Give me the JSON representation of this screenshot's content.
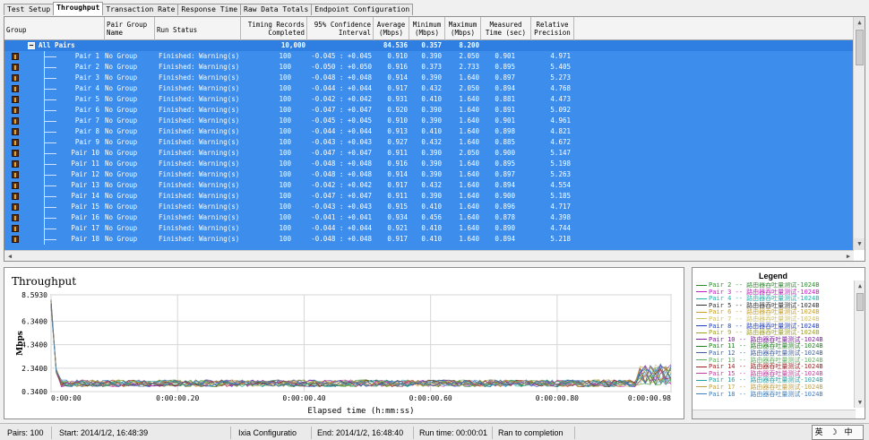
{
  "tabs": [
    "Test Setup",
    "Throughput",
    "Transaction Rate",
    "Response Time",
    "Raw Data Totals",
    "Endpoint Configuration"
  ],
  "active_tab": "Throughput",
  "table": {
    "headers": {
      "group": "Group",
      "pair_group_name": "Pair Group Name",
      "run_status": "Run Status",
      "timing_records": "Timing Records Completed",
      "confidence": "95% Confidence Interval",
      "average": "Average (Mbps)",
      "minimum": "Minimum (Mbps)",
      "maximum": "Maximum (Mbps)",
      "measured": "Measured Time (sec)",
      "precision": "Relative Precision"
    },
    "summary": {
      "label": "All Pairs",
      "records": "10,000",
      "average": "84.536",
      "minimum": "0.357",
      "maximum": "8.200"
    },
    "rows": [
      {
        "pair": "Pair 1",
        "group": "No Group",
        "status": "Finished: Warning(s)",
        "records": "100",
        "ci": "-0.045 : +0.045",
        "avg": "0.910",
        "min": "0.390",
        "max": "2.050",
        "time": "0.901",
        "prec": "4.971"
      },
      {
        "pair": "Pair 2",
        "group": "No Group",
        "status": "Finished: Warning(s)",
        "records": "100",
        "ci": "-0.050 : +0.050",
        "avg": "0.916",
        "min": "0.373",
        "max": "2.733",
        "time": "0.895",
        "prec": "5.405"
      },
      {
        "pair": "Pair 3",
        "group": "No Group",
        "status": "Finished: Warning(s)",
        "records": "100",
        "ci": "-0.048 : +0.048",
        "avg": "0.914",
        "min": "0.390",
        "max": "1.640",
        "time": "0.897",
        "prec": "5.273"
      },
      {
        "pair": "Pair 4",
        "group": "No Group",
        "status": "Finished: Warning(s)",
        "records": "100",
        "ci": "-0.044 : +0.044",
        "avg": "0.917",
        "min": "0.432",
        "max": "2.050",
        "time": "0.894",
        "prec": "4.768"
      },
      {
        "pair": "Pair 5",
        "group": "No Group",
        "status": "Finished: Warning(s)",
        "records": "100",
        "ci": "-0.042 : +0.042",
        "avg": "0.931",
        "min": "0.410",
        "max": "1.640",
        "time": "0.881",
        "prec": "4.473"
      },
      {
        "pair": "Pair 6",
        "group": "No Group",
        "status": "Finished: Warning(s)",
        "records": "100",
        "ci": "-0.047 : +0.047",
        "avg": "0.920",
        "min": "0.390",
        "max": "1.640",
        "time": "0.891",
        "prec": "5.092"
      },
      {
        "pair": "Pair 7",
        "group": "No Group",
        "status": "Finished: Warning(s)",
        "records": "100",
        "ci": "-0.045 : +0.045",
        "avg": "0.910",
        "min": "0.390",
        "max": "1.640",
        "time": "0.901",
        "prec": "4.961"
      },
      {
        "pair": "Pair 8",
        "group": "No Group",
        "status": "Finished: Warning(s)",
        "records": "100",
        "ci": "-0.044 : +0.044",
        "avg": "0.913",
        "min": "0.410",
        "max": "1.640",
        "time": "0.898",
        "prec": "4.821"
      },
      {
        "pair": "Pair 9",
        "group": "No Group",
        "status": "Finished: Warning(s)",
        "records": "100",
        "ci": "-0.043 : +0.043",
        "avg": "0.927",
        "min": "0.432",
        "max": "1.640",
        "time": "0.885",
        "prec": "4.672"
      },
      {
        "pair": "Pair 10",
        "group": "No Group",
        "status": "Finished: Warning(s)",
        "records": "100",
        "ci": "-0.047 : +0.047",
        "avg": "0.911",
        "min": "0.390",
        "max": "2.050",
        "time": "0.900",
        "prec": "5.147"
      },
      {
        "pair": "Pair 11",
        "group": "No Group",
        "status": "Finished: Warning(s)",
        "records": "100",
        "ci": "-0.048 : +0.048",
        "avg": "0.916",
        "min": "0.390",
        "max": "1.640",
        "time": "0.895",
        "prec": "5.198"
      },
      {
        "pair": "Pair 12",
        "group": "No Group",
        "status": "Finished: Warning(s)",
        "records": "100",
        "ci": "-0.048 : +0.048",
        "avg": "0.914",
        "min": "0.390",
        "max": "1.640",
        "time": "0.897",
        "prec": "5.263"
      },
      {
        "pair": "Pair 13",
        "group": "No Group",
        "status": "Finished: Warning(s)",
        "records": "100",
        "ci": "-0.042 : +0.042",
        "avg": "0.917",
        "min": "0.432",
        "max": "1.640",
        "time": "0.894",
        "prec": "4.554"
      },
      {
        "pair": "Pair 14",
        "group": "No Group",
        "status": "Finished: Warning(s)",
        "records": "100",
        "ci": "-0.047 : +0.047",
        "avg": "0.911",
        "min": "0.390",
        "max": "1.640",
        "time": "0.900",
        "prec": "5.185"
      },
      {
        "pair": "Pair 15",
        "group": "No Group",
        "status": "Finished: Warning(s)",
        "records": "100",
        "ci": "-0.043 : +0.043",
        "avg": "0.915",
        "min": "0.410",
        "max": "1.640",
        "time": "0.896",
        "prec": "4.717"
      },
      {
        "pair": "Pair 16",
        "group": "No Group",
        "status": "Finished: Warning(s)",
        "records": "100",
        "ci": "-0.041 : +0.041",
        "avg": "0.934",
        "min": "0.456",
        "max": "1.640",
        "time": "0.878",
        "prec": "4.398"
      },
      {
        "pair": "Pair 17",
        "group": "No Group",
        "status": "Finished: Warning(s)",
        "records": "100",
        "ci": "-0.044 : +0.044",
        "avg": "0.921",
        "min": "0.410",
        "max": "1.640",
        "time": "0.890",
        "prec": "4.744"
      },
      {
        "pair": "Pair 18",
        "group": "No Group",
        "status": "Finished: Warning(s)",
        "records": "100",
        "ci": "-0.048 : +0.048",
        "avg": "0.917",
        "min": "0.410",
        "max": "1.640",
        "time": "0.894",
        "prec": "5.218"
      }
    ]
  },
  "chart_data": {
    "type": "line",
    "title": "Throughput",
    "ylabel": "Mbps",
    "xlabel": "Elapsed time (h:mm:ss)",
    "yticks": [
      "8.5930",
      "6.3400",
      "4.3400",
      "2.3400",
      "0.3400"
    ],
    "xticks": [
      "0:00:00",
      "0:00:00.20",
      "0:00:00.40",
      "0:00:00.60",
      "0:00:00.80",
      "0:00:00.98"
    ],
    "ylim": [
      0.34,
      8.593
    ],
    "xlim": [
      0,
      0.98
    ],
    "grid": true,
    "legend_position": "right",
    "series_summary": "Pairs 1-18: initial spike near 8.2 Mbps at t=0, settling around 0.9-1.4 Mbps through 0.98s"
  },
  "legend": {
    "title": "Legend",
    "items": [
      {
        "label": "Pair 2 -- 路由器吞吐量测试-1024B",
        "color": "#2e8b2e"
      },
      {
        "label": "Pair 3 -- 路由器吞吐量测试-1024B",
        "color": "#c020c0"
      },
      {
        "label": "Pair 4 -- 路由器吞吐量测试-1024B",
        "color": "#20b0b0"
      },
      {
        "label": "Pair 5 -- 路由器吞吐量测试-1024B",
        "color": "#303030"
      },
      {
        "label": "Pair 6 -- 路由器吞吐量测试-1024B",
        "color": "#c8a020"
      },
      {
        "label": "Pair 7 -- 路由器吞吐量测试-1024B",
        "color": "#d0c060"
      },
      {
        "label": "Pair 8 -- 路由器吞吐量测试-1024B",
        "color": "#2040c0"
      },
      {
        "label": "Pair 9 -- 路由器吞吐量测试-1024B",
        "color": "#a0a020"
      },
      {
        "label": "Pair 10 -- 路由器吞吐量测试-1024B",
        "color": "#8020a0"
      },
      {
        "label": "Pair 11 -- 路由器吞吐量测试-1024B",
        "color": "#208020"
      },
      {
        "label": "Pair 12 -- 路由器吞吐量测试-1024B",
        "color": "#4060a0"
      },
      {
        "label": "Pair 13 -- 路由器吞吐量测试-1024B",
        "color": "#60b060"
      },
      {
        "label": "Pair 14 -- 路由器吞吐量测试-1024B",
        "color": "#a02020"
      },
      {
        "label": "Pair 15 -- 路由器吞吐量测试-1024B",
        "color": "#c040a0"
      },
      {
        "label": "Pair 16 -- 路由器吞吐量测试-1024B",
        "color": "#20a0a0"
      },
      {
        "label": "Pair 17 -- 路由器吞吐量测试-1024B",
        "color": "#c0a040"
      },
      {
        "label": "Pair 18 -- 路由器吞吐量测试-1024B",
        "color": "#4080c0"
      }
    ]
  },
  "status": {
    "pairs": "Pairs: 100",
    "start": "Start: 2014/1/2, 16:48:39",
    "config": "Ixia Configuratio",
    "end": "End: 2014/1/2, 16:48:40",
    "runtime": "Run time: 00:00:01",
    "completion": "Ran to completion",
    "ime": [
      "英",
      "☽",
      "中"
    ]
  }
}
